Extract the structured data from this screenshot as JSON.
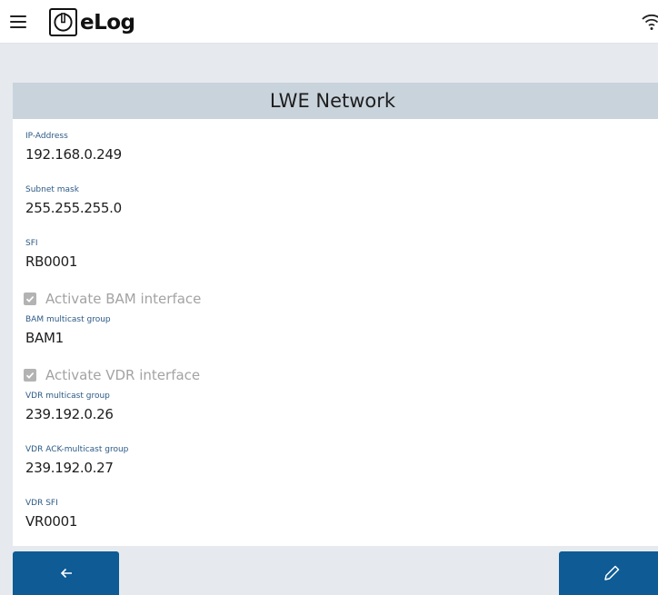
{
  "app": {
    "name": "eLog"
  },
  "page": {
    "title": "LWE Network"
  },
  "fields": {
    "ip_address": {
      "label": "IP-Address",
      "value": "192.168.0.249"
    },
    "subnet_mask": {
      "label": "Subnet mask",
      "value": "255.255.255.0"
    },
    "sfi": {
      "label": "SFI",
      "value": "RB0001"
    },
    "bam_multicast": {
      "label": "BAM multicast group",
      "value": "BAM1"
    },
    "vdr_multicast": {
      "label": "VDR multicast group",
      "value": "239.192.0.26"
    },
    "vdr_ack_multicast": {
      "label": "VDR ACK-multicast group",
      "value": "239.192.0.27"
    },
    "vdr_sfi": {
      "label": "VDR SFI",
      "value": "VR0001"
    }
  },
  "checkboxes": {
    "bam_interface": {
      "label": "Activate BAM interface",
      "checked": true,
      "disabled": true
    },
    "vdr_interface": {
      "label": "Activate VDR interface",
      "checked": true,
      "disabled": true
    }
  },
  "icons": {
    "menu": "hamburger-menu-icon",
    "logo": "power-logo-icon",
    "wifi": "wifi-icon",
    "back": "arrow-left-icon",
    "edit": "pencil-icon"
  },
  "colors": {
    "header_band": "#c9d3dc",
    "label": "#2c5a86",
    "button": "#0e5b95",
    "background": "#e6eaee"
  }
}
